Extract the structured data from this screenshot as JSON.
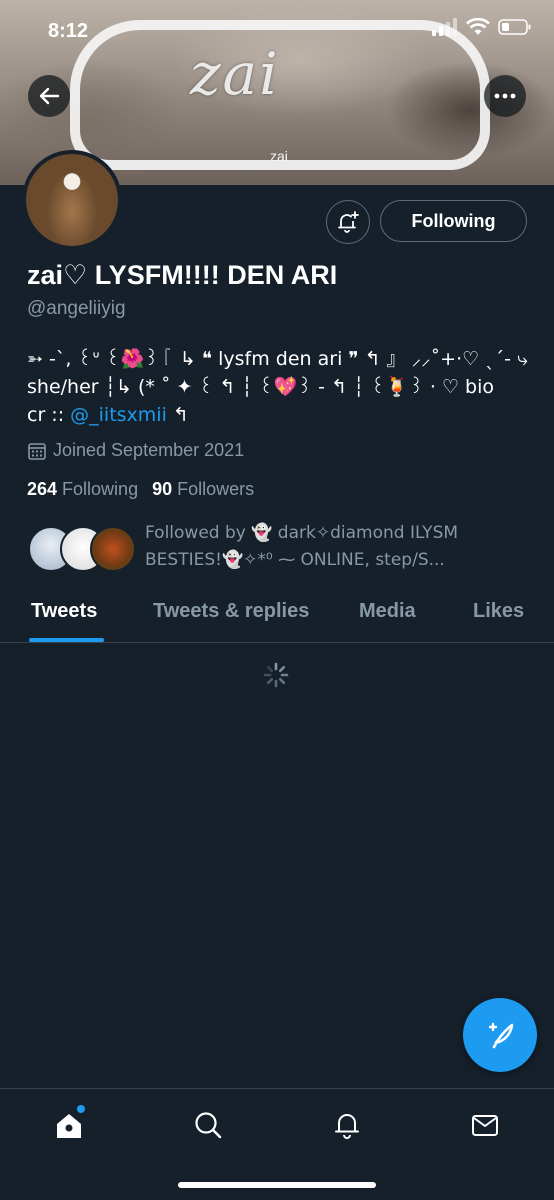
{
  "status_bar": {
    "time": "8:12"
  },
  "banner": {
    "swirl_text": "zai",
    "small_label": "zai"
  },
  "profile": {
    "display_name": "zai♡ LYSFM!!!! DEN ARI",
    "handle": "@angeliiyig",
    "bio_line1": "➳ -`, ꒰ᐡ ꒰🌺꒱『 ↳ ❝ lysfm den ari ❞ ↰ 』 ⸝⸝˚+·♡ ˎˊ- ⤷",
    "bio_line2": "she/her  ┆↳ (* ˚ ✦ ꒰ ↰ ┆ ꒰💖꒱ - ↰ ┆ ꒰🍹꒱ · ♡ bio",
    "bio_line3_prefix": "cr :: ",
    "bio_mention": "@_iitsxmii",
    "bio_line3_suffix": " ↰",
    "joined": "Joined September 2021",
    "following_count": "264",
    "following_label": "Following",
    "followers_count": "90",
    "followers_label": "Followers",
    "followed_by_line1": "Followed by 👻 dark✧diamond ILYSM",
    "followed_by_line2": "BESTIES!👻✧*⁰ ⁓ ONLINE, step/S..."
  },
  "actions": {
    "following_button": "Following"
  },
  "tabs": [
    {
      "label": "Tweets",
      "active": true
    },
    {
      "label": "Tweets & replies",
      "active": false
    },
    {
      "label": "Media",
      "active": false
    },
    {
      "label": "Likes",
      "active": false
    }
  ],
  "icons": {
    "back": "back-arrow-icon",
    "more": "more-icon",
    "notify": "bell-plus-icon",
    "calendar": "calendar-icon",
    "compose": "compose-icon",
    "home": "home-icon",
    "search": "search-icon",
    "notifications": "bell-icon",
    "messages": "mail-icon"
  },
  "colors": {
    "background": "#15202b",
    "accent": "#1d9bf0",
    "secondary_text": "#8899a6"
  }
}
